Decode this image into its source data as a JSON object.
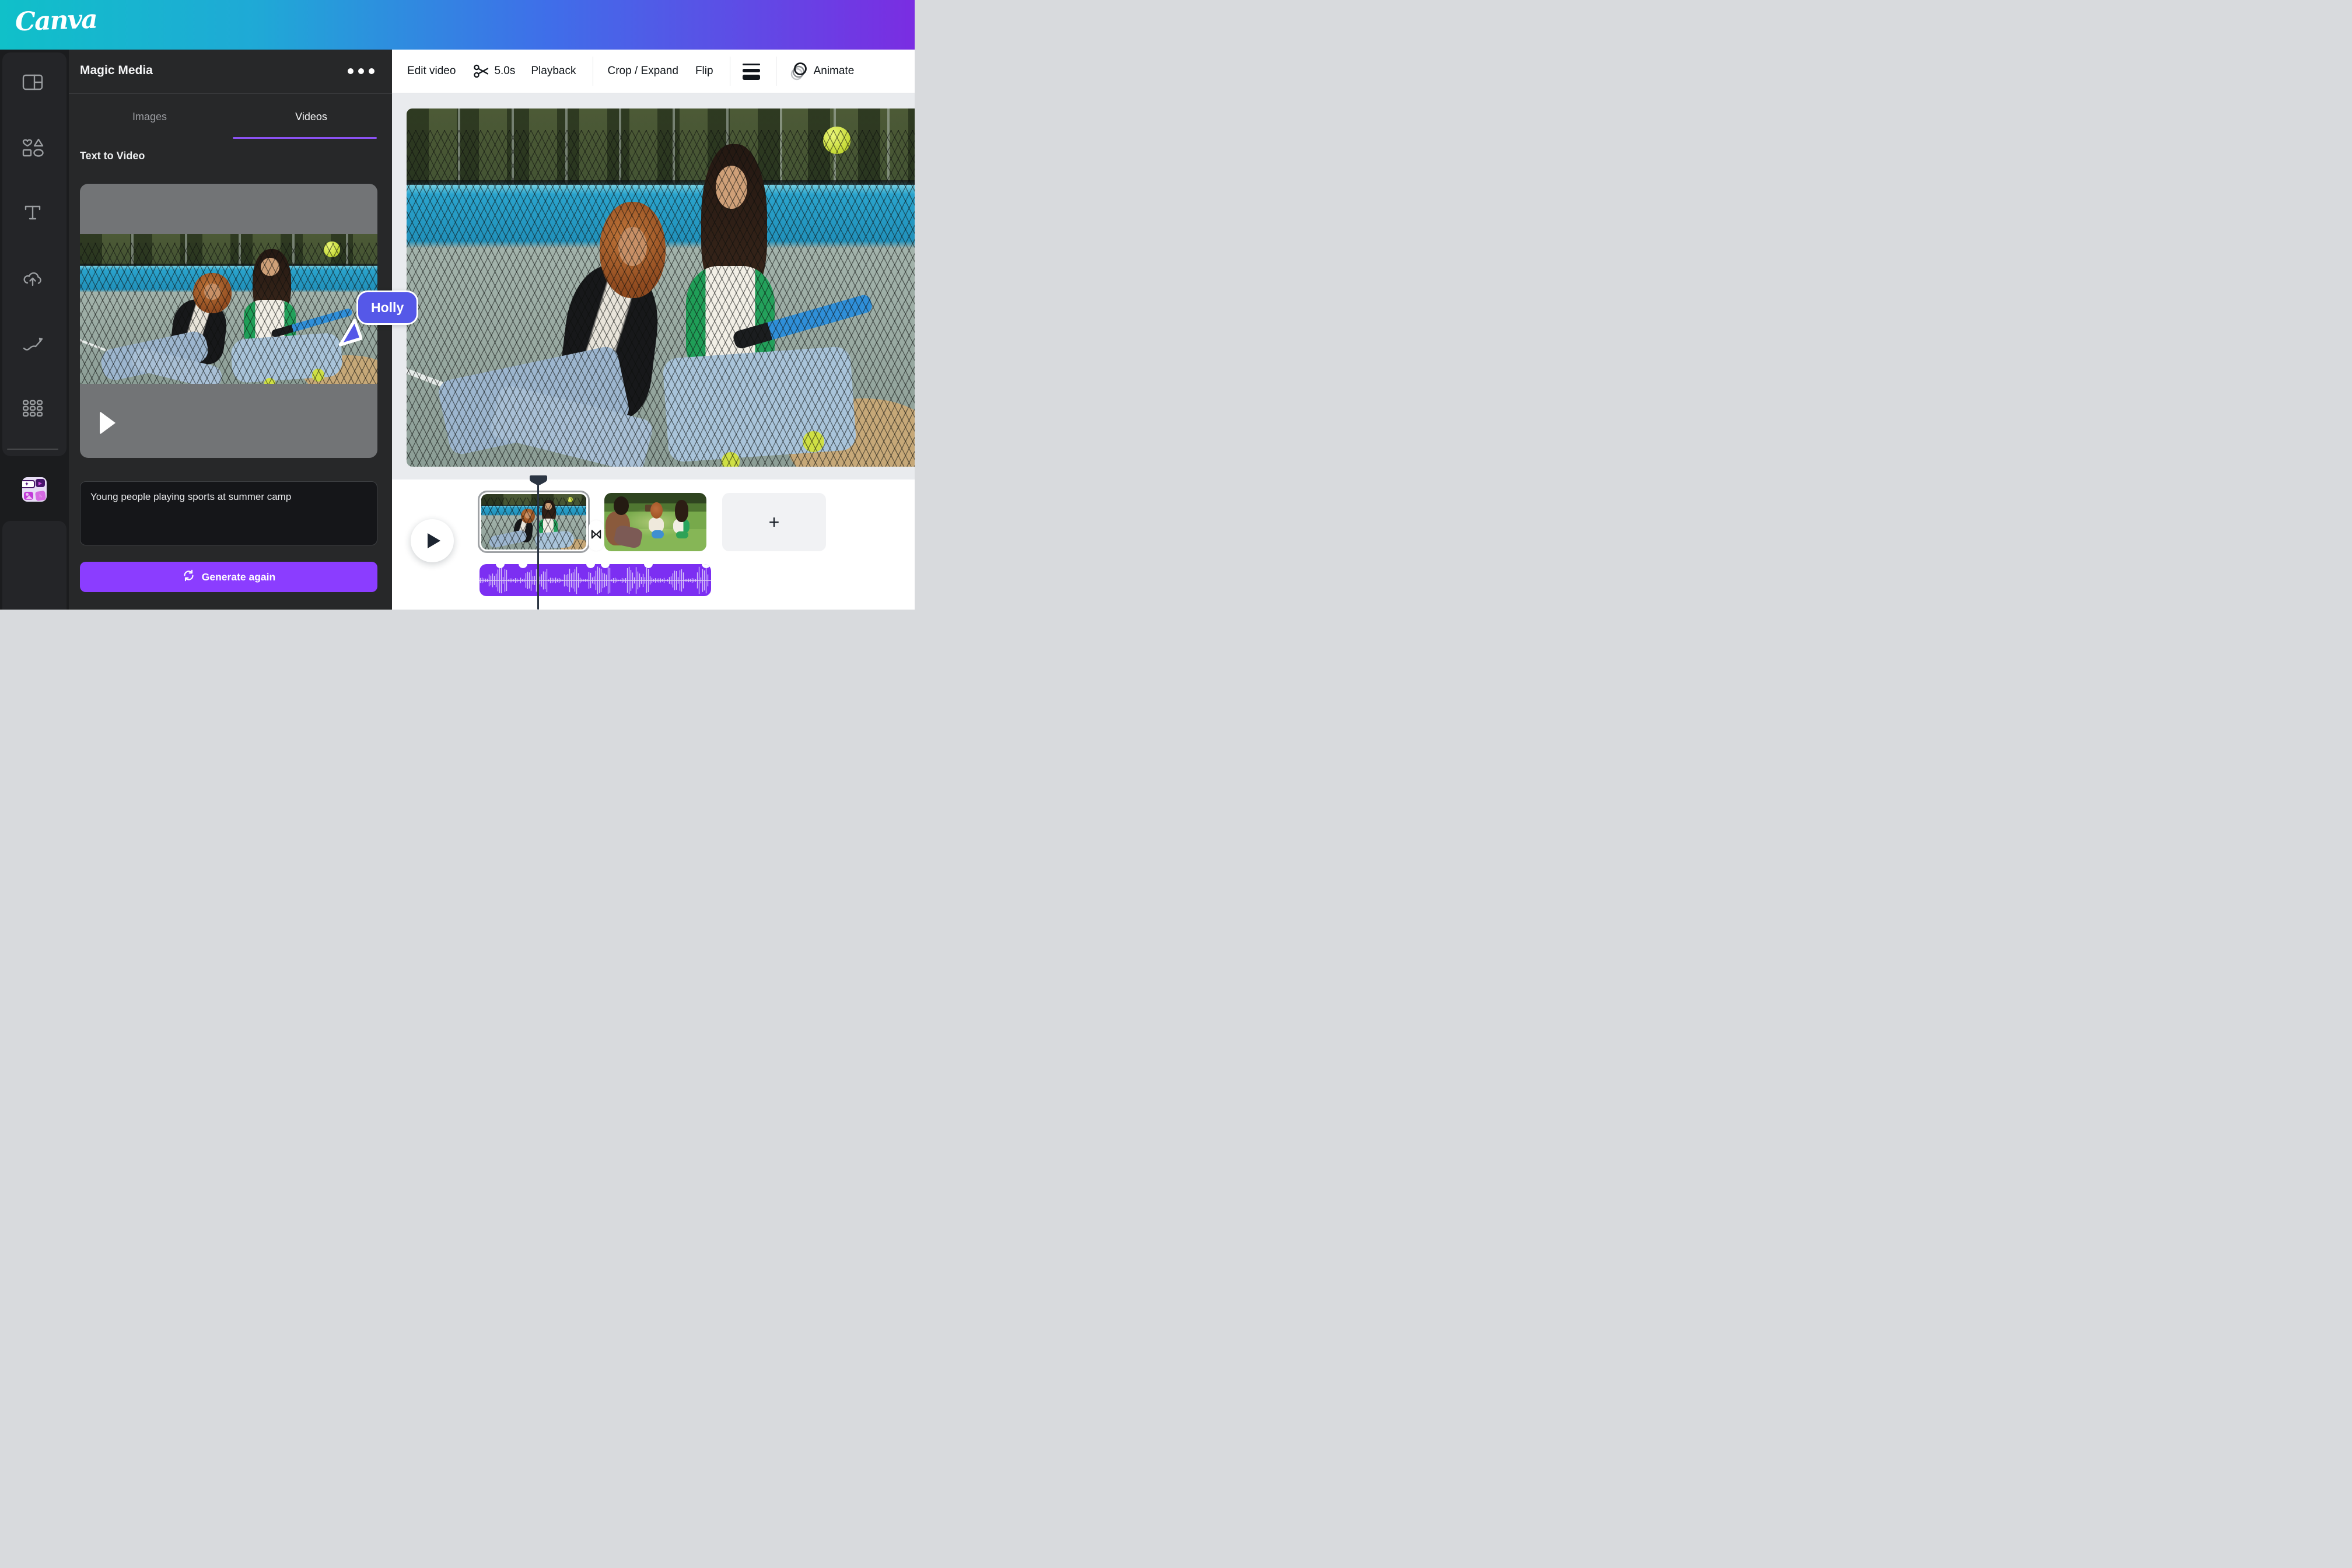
{
  "header": {
    "logo": "Canva"
  },
  "toolbar": {
    "edit_video": "Edit video",
    "duration": "5.0s",
    "playback": "Playback",
    "crop_expand": "Crop / Expand",
    "flip": "Flip",
    "animate": "Animate"
  },
  "sidebar": {
    "items": [
      {
        "name": "design",
        "icon": "design-grid-icon"
      },
      {
        "name": "elements",
        "icon": "shapes-icon"
      },
      {
        "name": "text",
        "icon": "text-icon"
      },
      {
        "name": "uploads",
        "icon": "cloud-upload-icon"
      },
      {
        "name": "draw",
        "icon": "draw-icon"
      },
      {
        "name": "apps",
        "icon": "apps-grid-icon"
      },
      {
        "name": "magic-media",
        "icon": "magic-media-badge"
      }
    ]
  },
  "panel": {
    "title": "Magic Media",
    "menu_icon": "•••",
    "tabs": {
      "images": "Images",
      "videos": "Videos"
    },
    "active_tab": "Videos",
    "section_title": "Text to Video",
    "prompt": "Young people playing sports at summer camp",
    "generate_label": "Generate again"
  },
  "canvas": {
    "collaborator": "Holly"
  },
  "timeline": {
    "add_label": "+",
    "selected_clip": "clip-1",
    "tracks": [
      "video",
      "audio"
    ]
  },
  "colors": {
    "accent_purple": "#8b3dff",
    "tab_underline": "#8b52f2",
    "waveform_purple": "#7c2ff2",
    "collaborator_blue": "#5558e8",
    "header_gradient_left": "#10c0c9",
    "header_gradient_right": "#7a2de2"
  }
}
